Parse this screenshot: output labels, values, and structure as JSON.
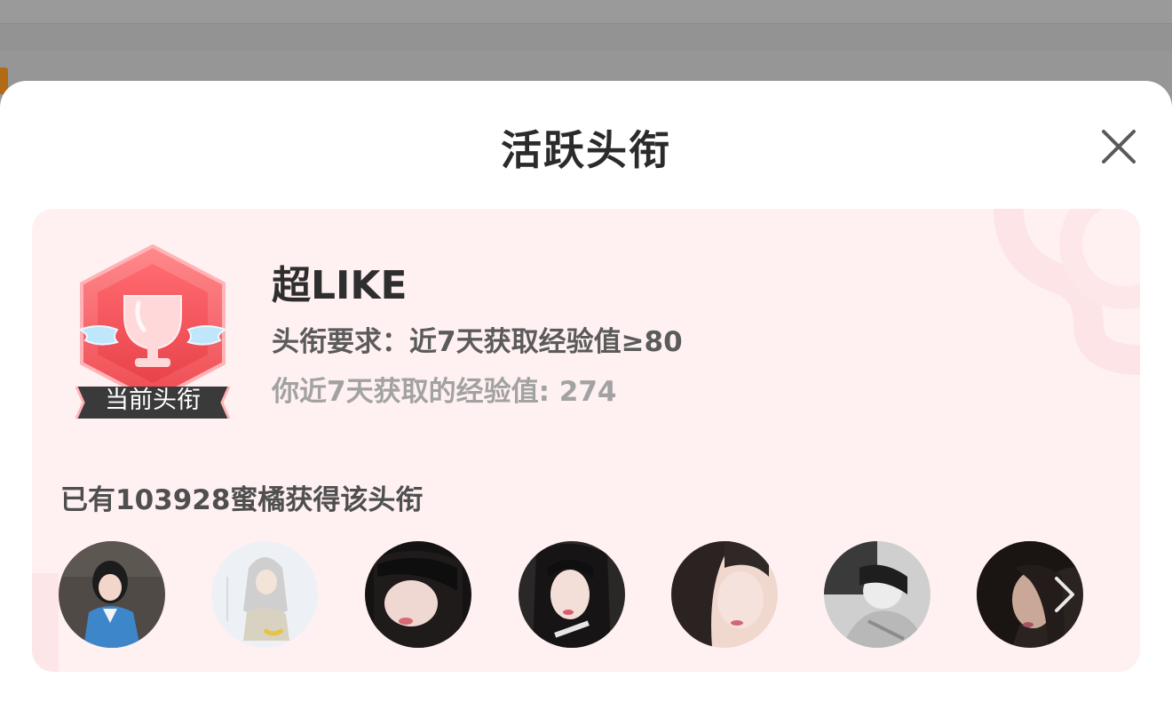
{
  "sheet": {
    "title": "活跃头衔",
    "close_icon": "close-icon"
  },
  "card": {
    "badge_label": "当前头衔",
    "badge_icon": "trophy-badge-icon",
    "title_name": "超LIKE",
    "requirement": "头衔要求：近7天获取经验值≥80",
    "my_experience": "你近7天获取的经验值: 274",
    "holders_count_text": "已有103928蜜橘获得该头衔",
    "more_icon": "chevron-right-icon"
  },
  "colors": {
    "card_background": "#fff1f2",
    "badge_red": "#f0585d",
    "badge_ribbon": "#3a3a3a",
    "title_text": "#2e2e2e",
    "secondary_text": "#a2a2a2"
  }
}
